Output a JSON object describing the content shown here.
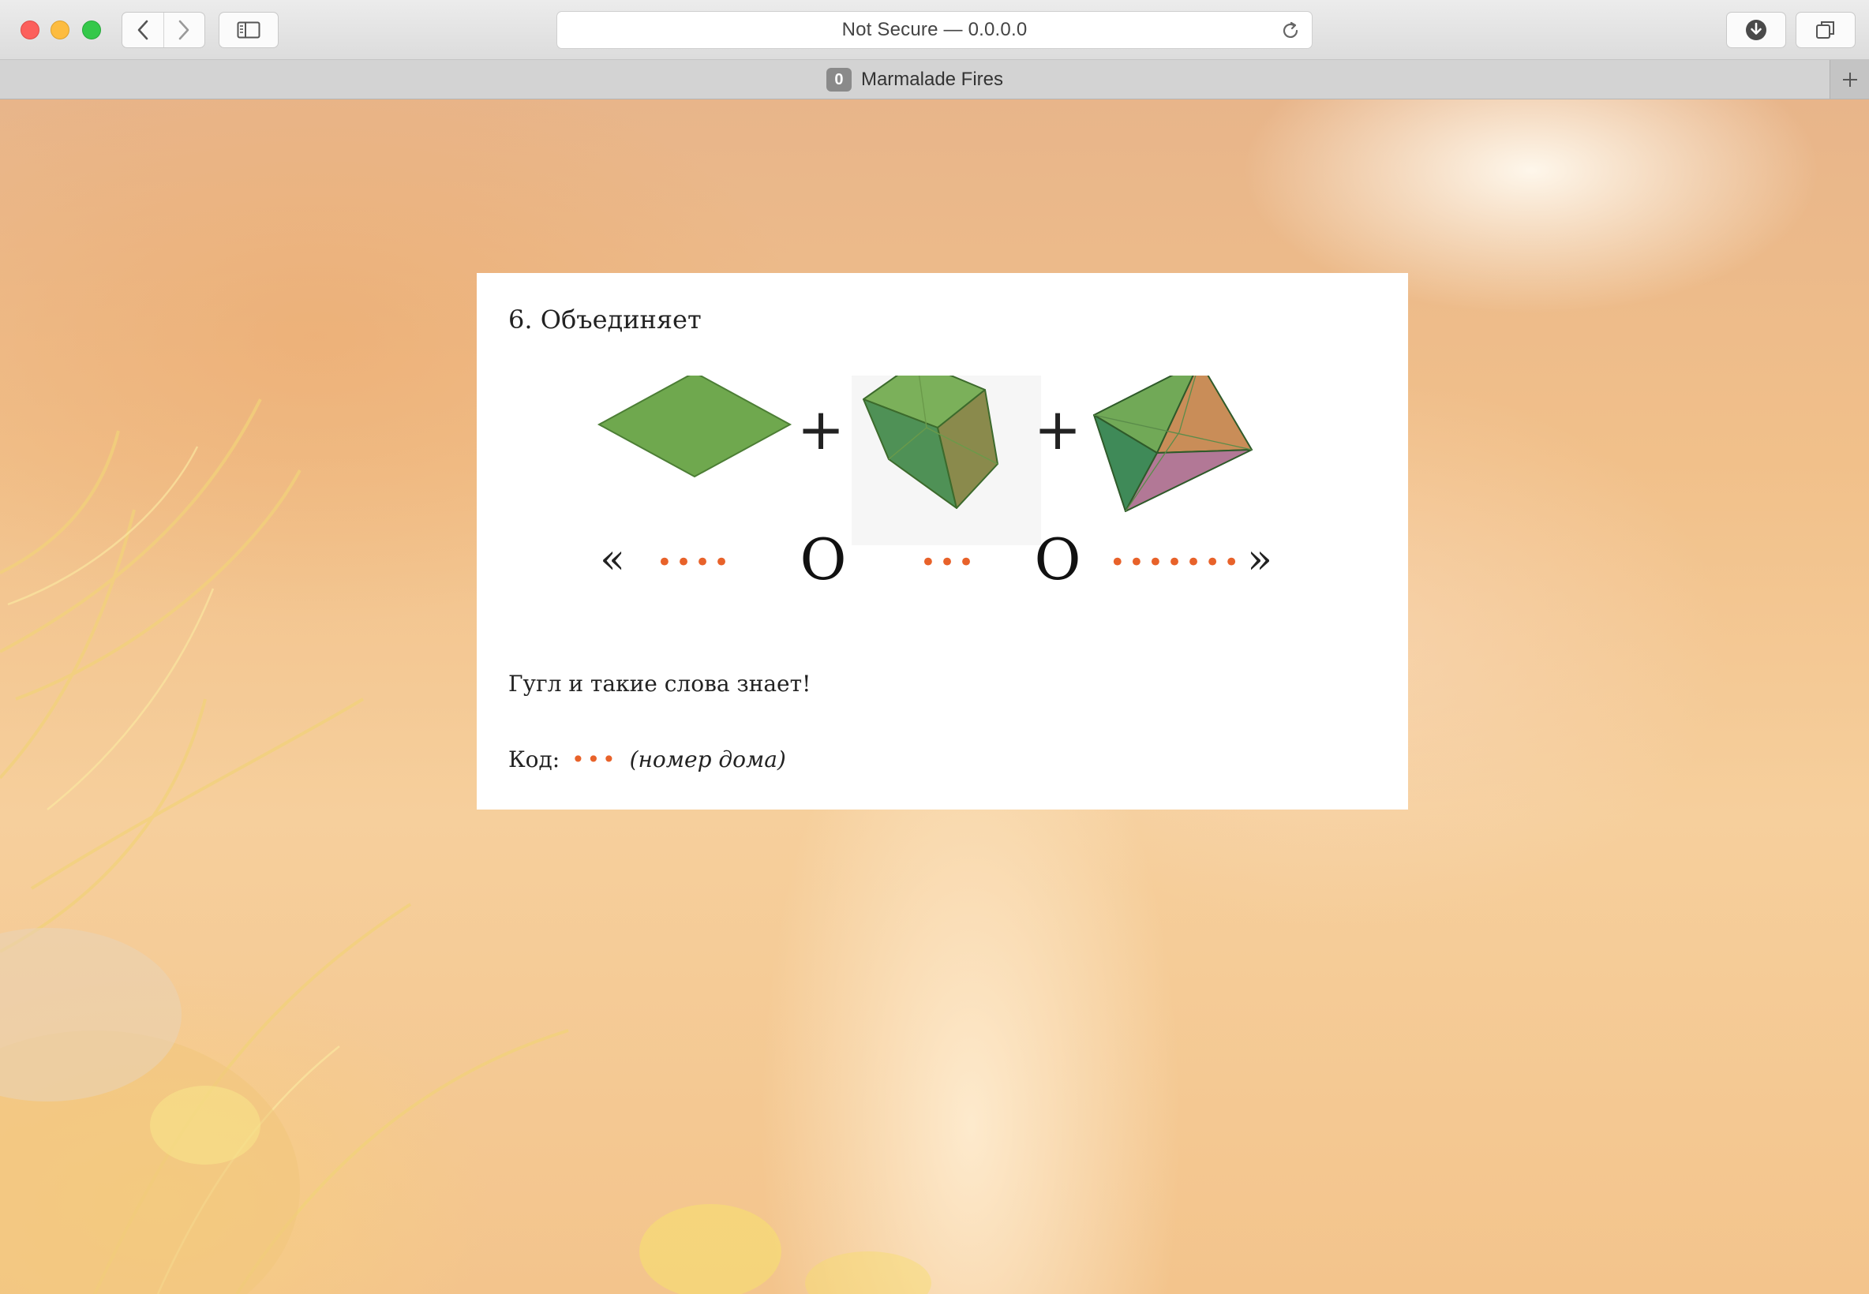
{
  "browser": {
    "url_text": "Not Secure — 0.0.0.0",
    "tab": {
      "badge": "0",
      "title": "Marmalade Fires"
    }
  },
  "content": {
    "heading": "6. Объединяет",
    "rebus": {
      "left_quote": "«",
      "right_quote": "»",
      "plus": "+",
      "letter": "O",
      "letters_groups": [
        "••••",
        "•••",
        "•••••••"
      ]
    },
    "paragraph": "Гугл и такие слова знает!",
    "code_label": "Код:",
    "code_dots": "•••",
    "code_hint": "(номер дома)"
  },
  "colors": {
    "accent_dots": "#e8622a",
    "solid_green": "#6fa84e"
  }
}
